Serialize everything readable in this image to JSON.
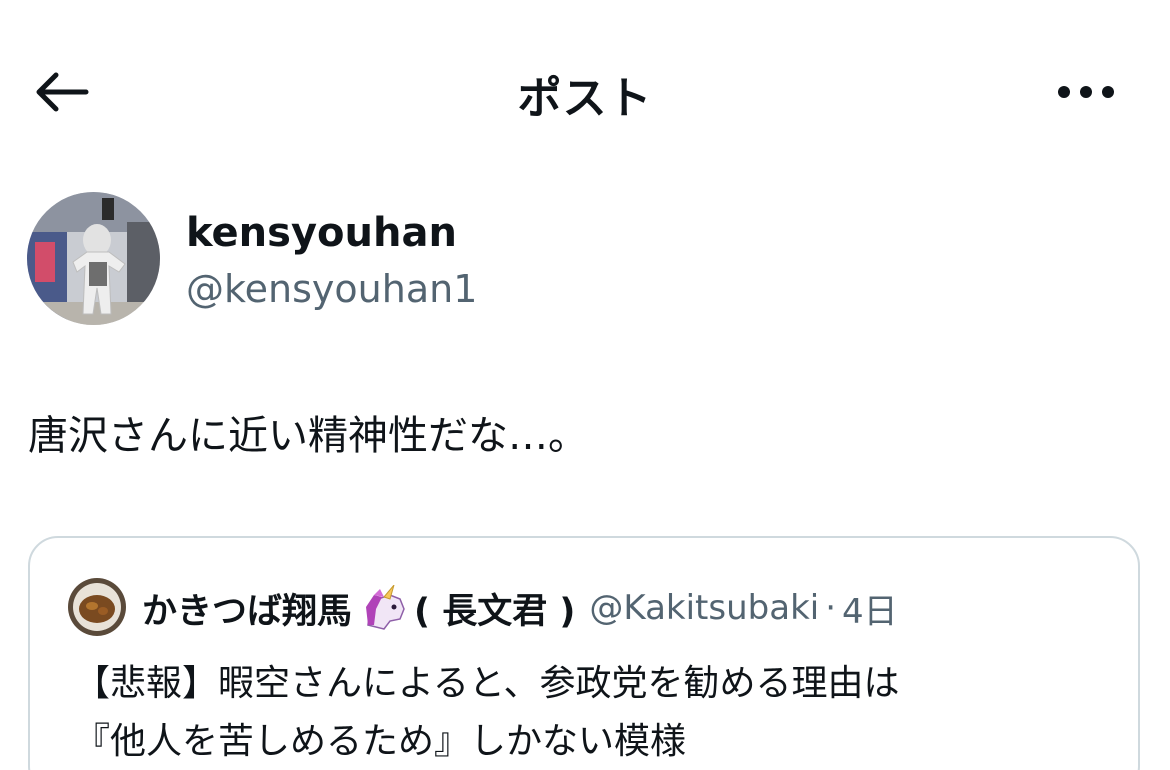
{
  "header": {
    "title": "ポスト",
    "back_icon": "arrow-left-icon",
    "more_icon": "ellipsis-icon"
  },
  "author": {
    "name": "kensyouhan",
    "handle": "@kensyouhan1",
    "avatar_icon": "profile-photo"
  },
  "post": {
    "text": "唐沢さんに近い精神性だな…。"
  },
  "quote": {
    "name": "かきつば翔馬",
    "emoji_icon": "unicorn-emoji",
    "name_suffix": "( 長文君 )",
    "handle": "@Kakitsubaki",
    "separator": "·",
    "time": "4日",
    "line1": "【悲報】暇空さんによると、参政党を勧める理由は",
    "line2": "『他人を苦しめるため』しかない模様"
  },
  "colors": {
    "text": "#0f1419",
    "secondary": "#536471",
    "border": "#cfd9de",
    "background": "#ffffff"
  }
}
